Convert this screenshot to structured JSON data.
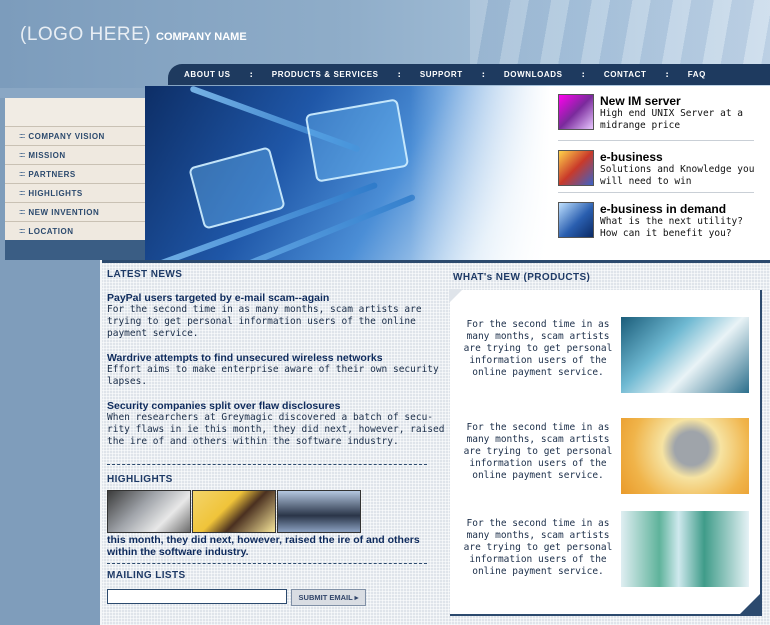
{
  "header": {
    "logo": "(LOGO HERE)",
    "company": "COMPANY NAME"
  },
  "nav": [
    {
      "label": "ABOUT US"
    },
    {
      "label": "PRODUCTS & SERVICES"
    },
    {
      "label": "SUPPORT"
    },
    {
      "label": "DOWNLOADS"
    },
    {
      "label": "CONTACT"
    },
    {
      "label": "FAQ"
    }
  ],
  "nav_separator": ":",
  "sidebar": {
    "bullet": "::::",
    "items": [
      {
        "label": "COMPANY VISION"
      },
      {
        "label": "MISSION"
      },
      {
        "label": "PARTNERS"
      },
      {
        "label": "HIGHLIGHTS"
      },
      {
        "label": "NEW INVENTION"
      },
      {
        "label": "LOCATION"
      }
    ]
  },
  "promos": [
    {
      "title": "New IM   server",
      "text": "High end UNIX Server at a midrange price",
      "icon": "server-icon"
    },
    {
      "title": "e-business",
      "text": "Solutions and Knowledge you will need to win",
      "icon": "chart-icon"
    },
    {
      "title": "e-business in demand",
      "text": "What is the next utility? How can it benefit you?",
      "icon": "network-icon"
    }
  ],
  "latest_news": {
    "title": "LATEST NEWS",
    "items": [
      {
        "headline": "PayPal users targeted by e-mail scam--again",
        "body": "For the second time in as many months, scam artists are trying to get personal information users of the online payment service."
      },
      {
        "headline": "Wardrive attempts to find unsecured wireless networks",
        "body": "Effort aims to make enterprise aware of their own security lapses."
      },
      {
        "headline": "Security companies split over flaw disclosures",
        "body": "When researchers at Greymagic discovered a batch of secu- rity flaws in ie this month, they did next, however, raised the ire of and others within the software industry."
      }
    ]
  },
  "highlights": {
    "title": "HIGHLIGHTS",
    "text": "this month, they did next, however, raised the ire of and others within the software industry."
  },
  "mailing": {
    "title": "MAILING LISTS",
    "placeholder": "",
    "submit_label": "SUBMIT EMAIL ▸"
  },
  "products": {
    "title": "WHAT's NEW (PRODUCTS)",
    "items": [
      {
        "text": "For the second time in as many months, scam artists are trying to get personal information users of the online payment service.",
        "image": "printer"
      },
      {
        "text": "For the second time in as many months, scam artists are trying to get personal information users of the online payment service.",
        "image": "phone"
      },
      {
        "text": "For the second time in as many months, scam artists are trying to get personal information users of the online payment service.",
        "image": "batteries"
      }
    ]
  }
}
